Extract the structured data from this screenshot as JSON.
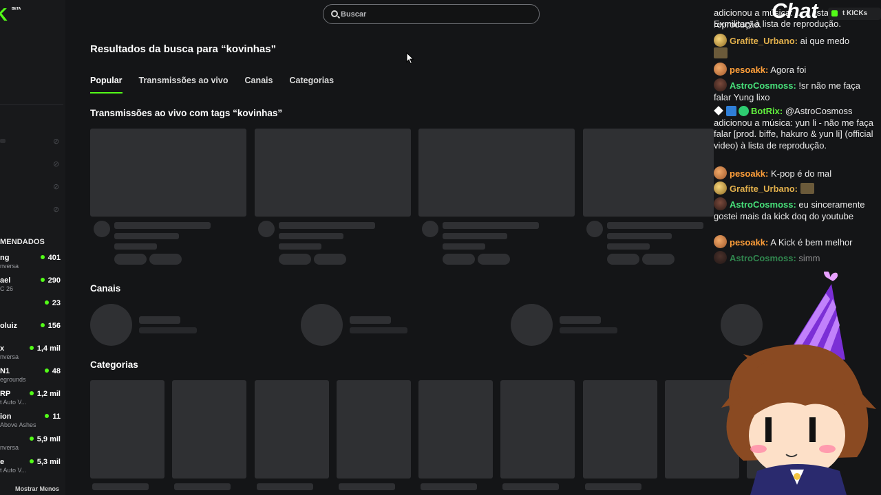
{
  "brand": {
    "logo_text": "K",
    "beta_label": "BETA"
  },
  "search": {
    "placeholder": "Buscar",
    "value": ""
  },
  "results": {
    "title": "Resultados da busca para “kovinhas”",
    "tabs": [
      {
        "label": "Popular",
        "active": true
      },
      {
        "label": "Transmissões ao vivo",
        "active": false
      },
      {
        "label": "Canais",
        "active": false
      },
      {
        "label": "Categorias",
        "active": false
      }
    ],
    "sections": {
      "live": "Transmissões ao vivo com tags “kovinhas”",
      "channels": "Canais",
      "categories": "Categorias"
    }
  },
  "sidebar": {
    "recommended_title": "MENDADOS",
    "recommended": [
      {
        "name": "ng",
        "sub": "nversa",
        "viewers": "401"
      },
      {
        "name": "ael",
        "sub": "C 26",
        "viewers": "290"
      },
      {
        "name": "",
        "sub": "",
        "viewers": "23"
      },
      {
        "name": "oluiz",
        "sub": "",
        "viewers": "156"
      },
      {
        "name": "x",
        "sub": "nversa",
        "viewers": "1,4 mil"
      },
      {
        "name": "N1",
        "sub": "egrounds",
        "viewers": "48"
      },
      {
        "name": "RP",
        "sub": "t Auto V...",
        "viewers": "1,2 mil"
      },
      {
        "name": "ion",
        "sub": "Above Ashes",
        "viewers": "11"
      },
      {
        "name": "",
        "sub": "nversa",
        "viewers": "5,9 mil"
      },
      {
        "name": "e",
        "sub": "t Auto V...",
        "viewers": "5,3 mil"
      }
    ],
    "show_less": "Mostrar Menos"
  },
  "overlay": {
    "chat_title": "Chat",
    "kicks_label": "t KICKs",
    "messages": [
      {
        "user": "",
        "color": "#e9e9e9",
        "text": "adicionou a música: ... à lista de reprodução."
      },
      {
        "user": "",
        "color": "#e9e9e9",
        "text": "Exmilitary à lista de reprodução."
      },
      {
        "user": "Grafite_Urbano",
        "text": " ai que medo"
      },
      {
        "user": "pesoakk",
        "text": " Agora foi"
      },
      {
        "user": "AstroCosmoss",
        "text": " !sr não me faça falar Yung lixo"
      },
      {
        "user": "BotRix",
        "text": " @AstroCosmoss adicionou a música: yun li - não me faça falar [prod. biffe, hakuro & yun li] (official video) à lista de reprodução."
      },
      {
        "user": "pesoakk",
        "text": " K-pop é do mal"
      },
      {
        "user": "Grafite_Urbano",
        "text": ""
      },
      {
        "user": "AstroCosmoss",
        "text": " eu sinceramente gostei mais da kick doq do youtube"
      },
      {
        "user": "pesoakk",
        "text": " A Kick é bem melhor"
      },
      {
        "user": "AstroCosmoss",
        "text": " simm"
      }
    ]
  },
  "colors": {
    "accent": "#53fc18",
    "bg": "#141517",
    "skeleton": "#2f3033"
  }
}
